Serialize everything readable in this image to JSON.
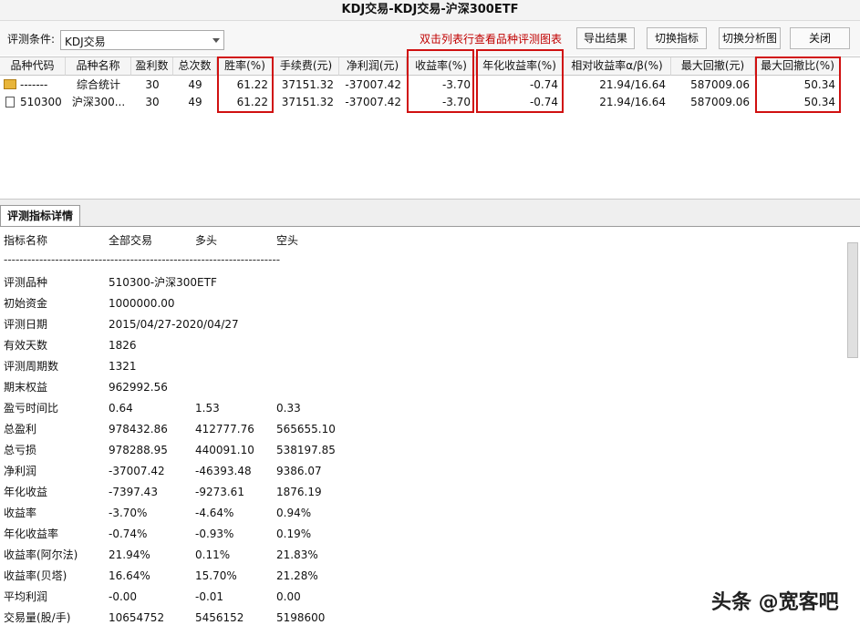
{
  "window": {
    "title": "KDJ交易-KDJ交易-沪深300ETF"
  },
  "toolbar": {
    "condition_label": "评测条件:",
    "condition_value": "KDJ交易",
    "hint": "双击列表行查看品种评测图表",
    "buttons": [
      "导出结果",
      "切换指标",
      "切换分析图",
      "关闭"
    ]
  },
  "grid": {
    "columns": [
      "品种代码",
      "品种名称",
      "盈利数",
      "总次数",
      "胜率(%)",
      "手续费(元)",
      "净利润(元)",
      "收益率(%)",
      "年化收益率(%)",
      "相对收益率α/β(%)",
      "最大回撤(元)",
      "最大回撤比(%)"
    ],
    "rows": [
      [
        "-------",
        "综合统计",
        "30",
        "49",
        "61.22",
        "37151.32",
        "-37007.42",
        "-3.70",
        "-0.74",
        "21.94/16.64",
        "587009.06",
        "50.34"
      ],
      [
        "510300",
        "沪深300...",
        "30",
        "49",
        "61.22",
        "37151.32",
        "-37007.42",
        "-3.70",
        "-0.74",
        "21.94/16.64",
        "587009.06",
        "50.34"
      ]
    ]
  },
  "tabs": {
    "detail": "评测指标详情"
  },
  "detail": {
    "header": [
      "指标名称",
      "全部交易",
      "多头",
      "空头"
    ],
    "separator": "----------------------------------------------------------------------",
    "rows": [
      [
        "评测品种",
        "510300-沪深300ETF",
        "",
        ""
      ],
      [
        "初始资金",
        "1000000.00",
        "",
        ""
      ],
      [
        "评测日期",
        "2015/04/27-2020/04/27",
        "",
        ""
      ],
      [
        "有效天数",
        "1826",
        "",
        ""
      ],
      [
        "评测周期数",
        "1321",
        "",
        ""
      ],
      [
        "期末权益",
        "962992.56",
        "",
        ""
      ],
      [
        "盈亏时间比",
        "0.64",
        "1.53",
        "0.33"
      ],
      [
        "总盈利",
        "978432.86",
        "412777.76",
        "565655.10"
      ],
      [
        "总亏损",
        "978288.95",
        "440091.10",
        "538197.85"
      ],
      [
        "净利润",
        "-37007.42",
        "-46393.48",
        "9386.07"
      ],
      [
        "年化收益",
        "-7397.43",
        "-9273.61",
        "1876.19"
      ],
      [
        "收益率",
        "-3.70%",
        "-4.64%",
        "0.94%"
      ],
      [
        "年化收益率",
        "-0.74%",
        "-0.93%",
        "0.19%"
      ],
      [
        "收益率(阿尔法)",
        "21.94%",
        "0.11%",
        "21.83%"
      ],
      [
        "收益率(贝塔)",
        "16.64%",
        "15.70%",
        "21.28%"
      ],
      [
        "平均利润",
        "-0.00",
        "-0.01",
        "0.00"
      ],
      [
        "交易量(股/手)",
        "10654752",
        "5456152",
        "5198600"
      ]
    ]
  },
  "watermark": "头条 @宽客吧",
  "colors": {
    "highlight": "#d01010",
    "hint": "#c00000"
  }
}
